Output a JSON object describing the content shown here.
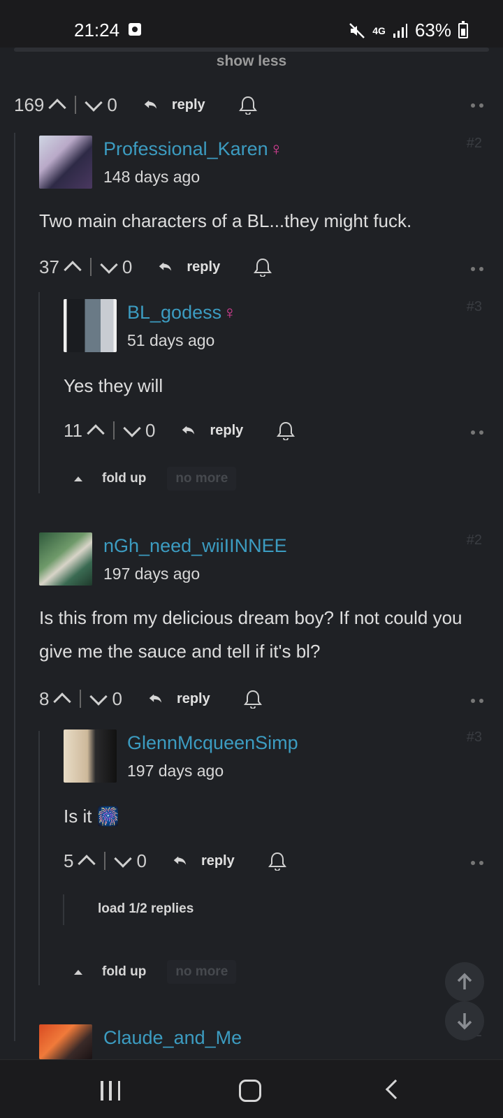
{
  "status_bar": {
    "time": "21:24",
    "network": "4G",
    "battery": "63%"
  },
  "thread": {
    "show_less_label": "show less",
    "reply_label": "reply",
    "fold_up_label": "fold up",
    "no_more_label": "no more",
    "root_actions": {
      "likes": "169",
      "dislikes": "0"
    }
  },
  "comments": [
    {
      "username": "Professional_Karen",
      "gender_symbol": "♀",
      "date": "148 days ago",
      "floor": "#2",
      "text": "Two main characters of a BL...they might fuck.",
      "likes": "37",
      "dislikes": "0",
      "replies": [
        {
          "username": "BL_godess",
          "gender_symbol": "♀",
          "date": "51 days ago",
          "floor": "#3",
          "text": "Yes they will",
          "likes": "11",
          "dislikes": "0"
        }
      ]
    },
    {
      "username": "nGh_need_wiiIINNEE",
      "date": "197 days ago",
      "floor": "#2",
      "text": "Is this from my delicious dream boy? If not could you give me the sauce and tell if it's bl?",
      "likes": "8",
      "dislikes": "0",
      "replies": [
        {
          "username": "GlennMcqueenSimp",
          "date": "197 days ago",
          "floor": "#3",
          "text": "Is it",
          "emoji": "🎆",
          "likes": "5",
          "dislikes": "0",
          "load_replies_label": "load 1/2 replies"
        }
      ]
    },
    {
      "username": "Claude_and_Me",
      "floor": "#2"
    }
  ],
  "colors": {
    "background": "#1f2125",
    "username": "#3c9cc1",
    "female_symbol": "#e0409a"
  }
}
